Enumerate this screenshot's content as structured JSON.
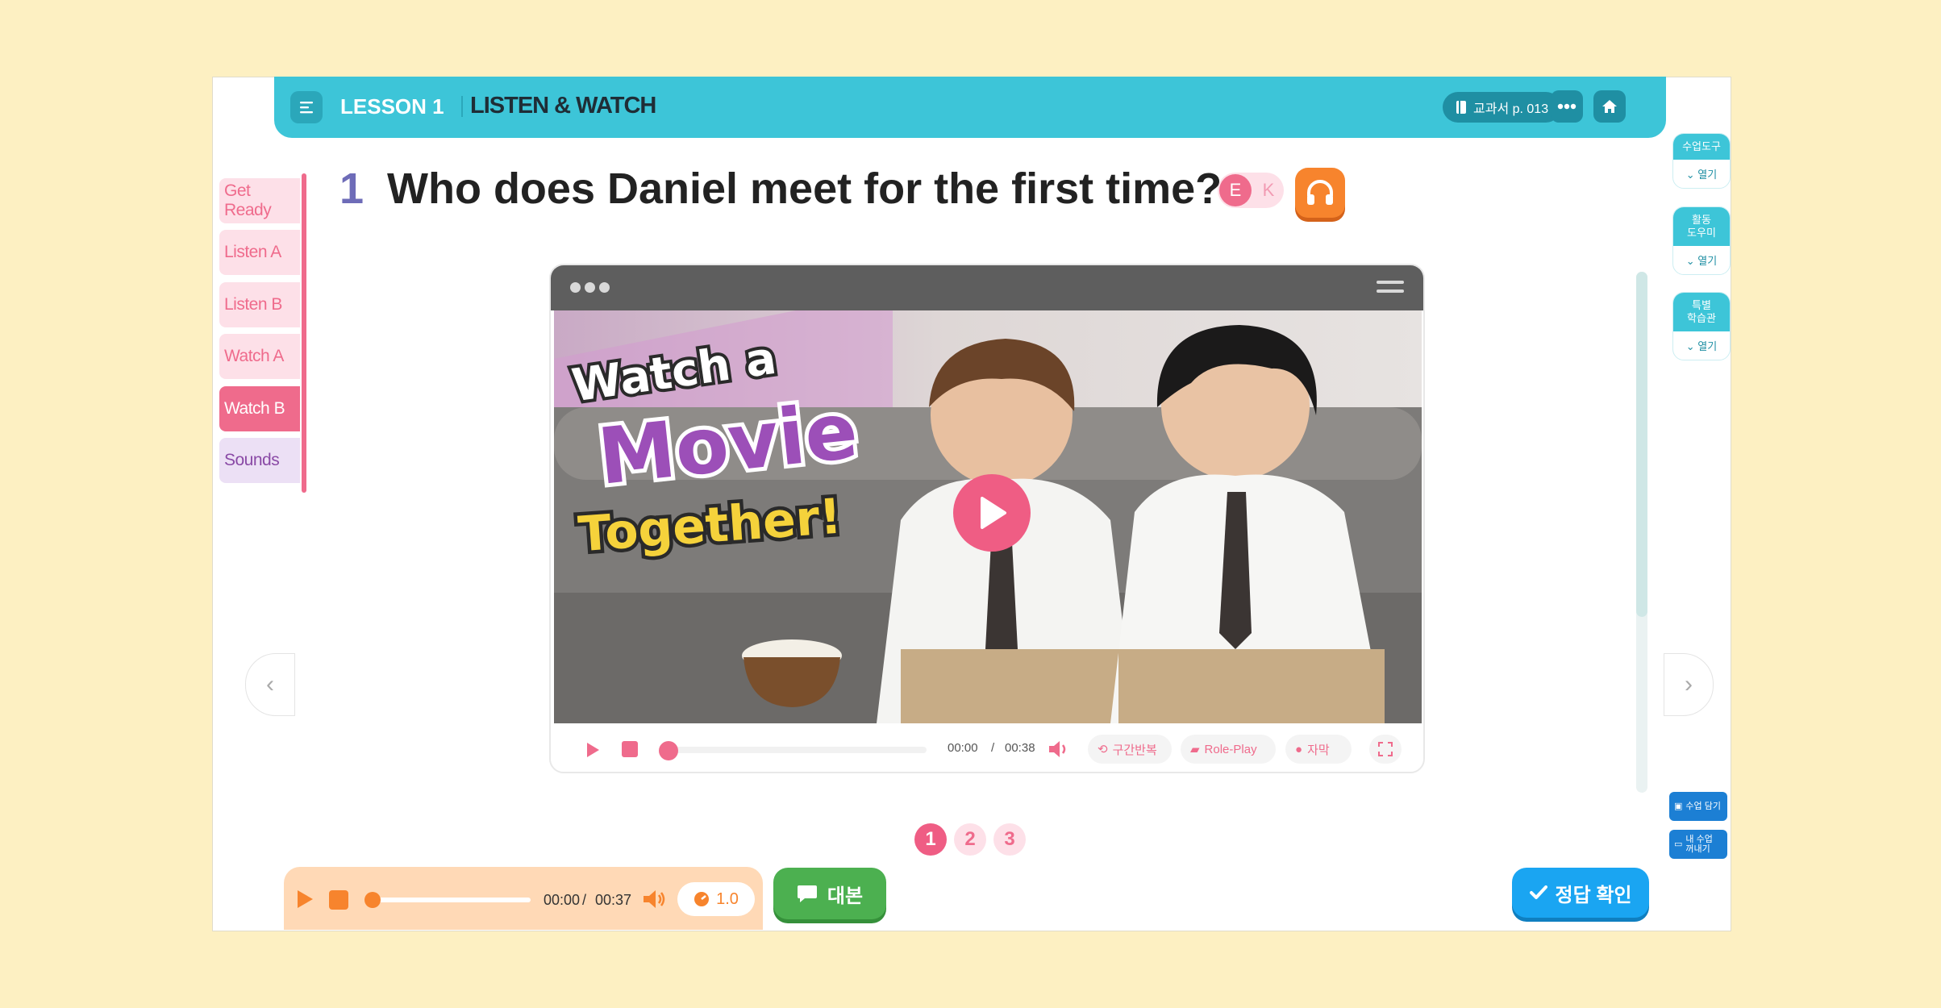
{
  "header": {
    "lesson": "LESSON 1",
    "title": "LISTEN & WATCH",
    "book_ref": "교과서 p. 013",
    "more_icon": "ellipsis-icon",
    "home_icon": "home-icon"
  },
  "sidebar": {
    "items": [
      {
        "label": "Get Ready"
      },
      {
        "label": "Listen A"
      },
      {
        "label": "Listen B"
      },
      {
        "label": "Watch A"
      },
      {
        "label": "Watch B",
        "active": true
      },
      {
        "label": "Sounds"
      }
    ]
  },
  "question": {
    "number": "1",
    "text": "Who does Daniel meet for the first time?",
    "lang_e": "E",
    "lang_k": "K"
  },
  "video": {
    "current_time": "00:00",
    "separator": "/",
    "duration": "00:38",
    "progress": 0,
    "repeat_label": "구간반복",
    "roleplay_label": "Role-Play",
    "caption_label": "자막",
    "thumbnail_title_1": "Watch a",
    "thumbnail_title_2": "Movie",
    "thumbnail_title_3": "Together!"
  },
  "pages": [
    "1",
    "2",
    "3"
  ],
  "active_page": 0,
  "tools": [
    {
      "title": "수업도구",
      "action": "열기"
    },
    {
      "title": "활동\n도우미",
      "action": "열기"
    },
    {
      "title": "특별\n학습관",
      "action": "열기"
    }
  ],
  "side_buttons": [
    {
      "label": "수업 담기"
    },
    {
      "label": "내 수업\n꺼내기"
    }
  ],
  "audio": {
    "current_time": "00:00",
    "separator": "/",
    "duration": "00:37",
    "speed": "1.0",
    "progress": 0
  },
  "script_button": "대본",
  "answer_button": "정답 확인",
  "colors": {
    "background": "#fdf0c2",
    "header": "#3dc5d8",
    "accent_pink": "#ef6b8c",
    "accent_orange": "#f7842d",
    "green": "#4cb050",
    "blue": "#1aa5f2"
  }
}
